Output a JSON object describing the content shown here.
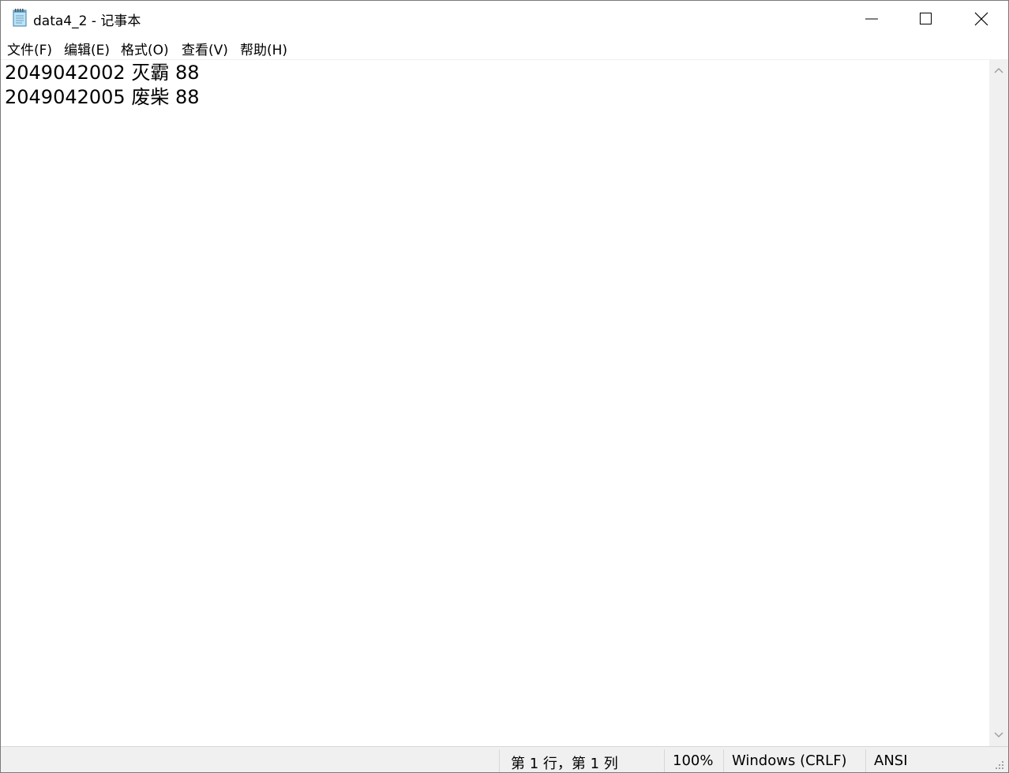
{
  "window": {
    "title": "data4_2 - 记事本",
    "icon": "notepad-icon",
    "controls": {
      "minimize": "minimize-icon",
      "maximize": "maximize-icon",
      "close": "close-icon"
    }
  },
  "menu": [
    {
      "label": "文件(F)"
    },
    {
      "label": "编辑(E)"
    },
    {
      "label": "格式(O)"
    },
    {
      "label": "查看(V)"
    },
    {
      "label": "帮助(H)"
    }
  ],
  "editor": {
    "lines": [
      "2049042002 灭霸 88",
      "2049042005 废柴 88"
    ]
  },
  "statusbar": {
    "position": "第 1 行，第 1 列",
    "zoom": "100%",
    "line_ending": "Windows (CRLF)",
    "encoding": "ANSI"
  },
  "colors": {
    "chrome_bg": "#f0f0f0",
    "border": "#7a7a7a"
  }
}
